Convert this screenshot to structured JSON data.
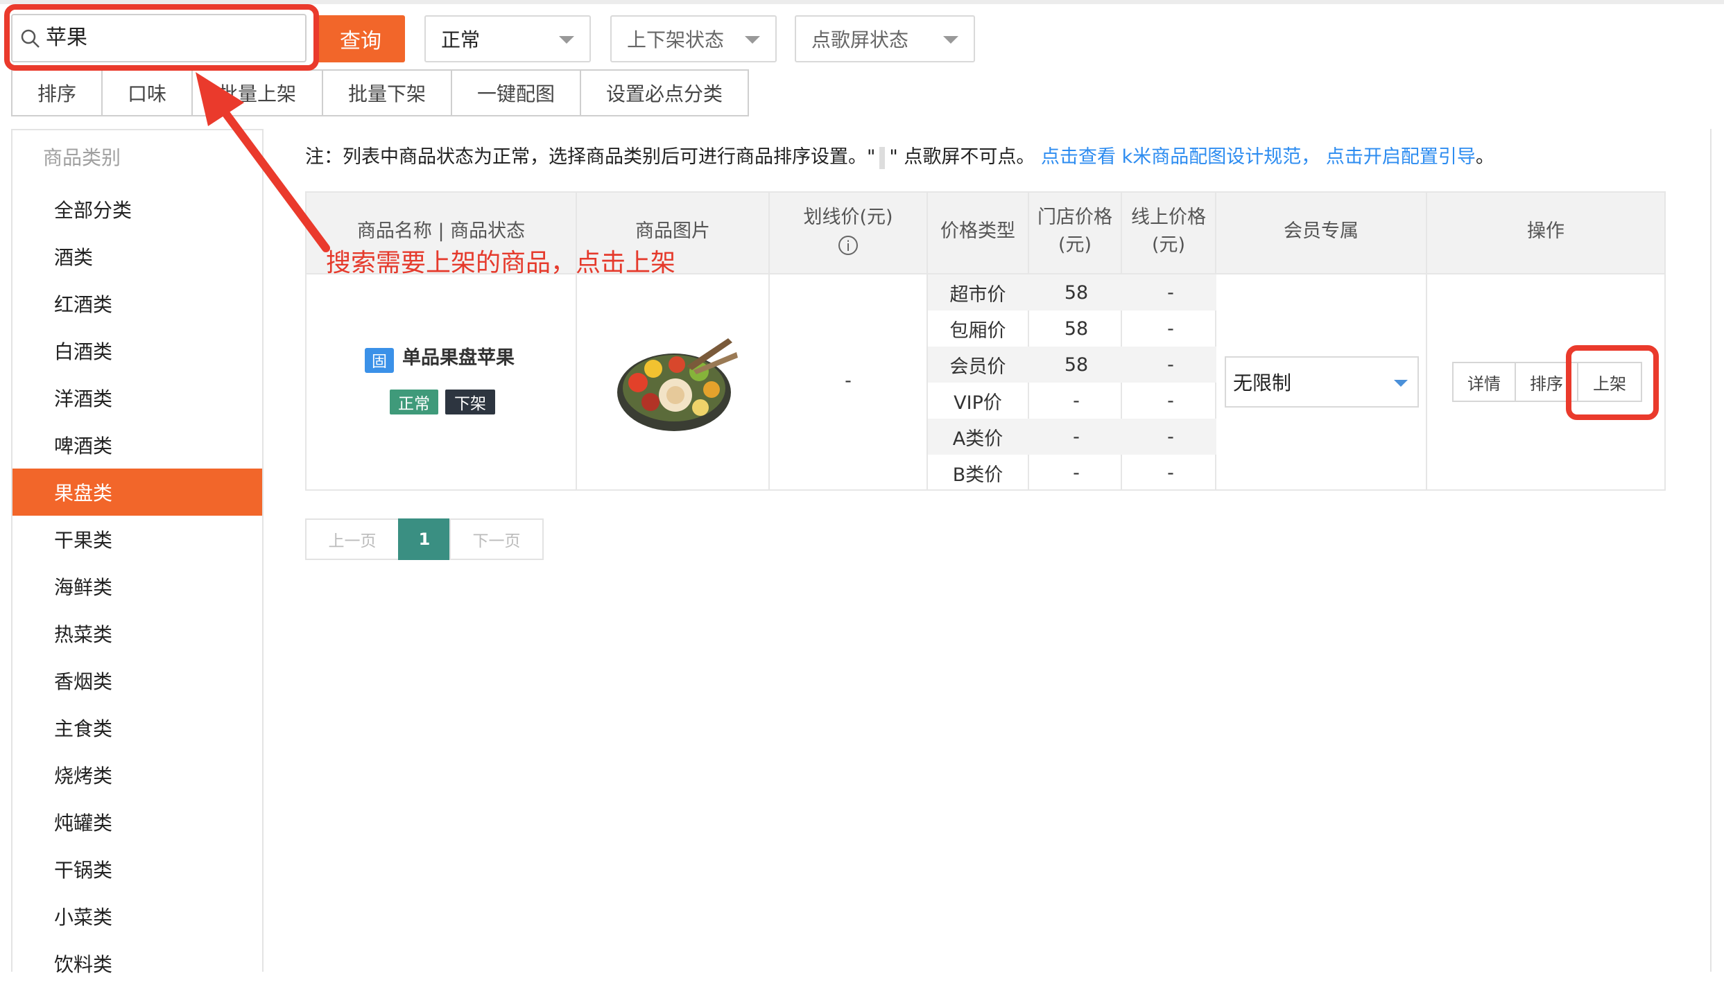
{
  "search": {
    "value": "苹果",
    "button": "查询"
  },
  "filters": {
    "status": "正常",
    "shelf_status": "上下架状态",
    "screen_status": "点歌屏状态"
  },
  "tabs": [
    "排序",
    "口味",
    "批量上架",
    "批量下架",
    "一键配图",
    "设置必点分类"
  ],
  "sidebar": {
    "header": "商品类别",
    "items": [
      "全部分类",
      "酒类",
      "红酒类",
      "白酒类",
      "洋酒类",
      "啤酒类",
      "果盘类",
      "干果类",
      "海鲜类",
      "热菜类",
      "香烟类",
      "主食类",
      "烧烤类",
      "炖罐类",
      "干锅类",
      "小菜类",
      "饮料类"
    ],
    "active_index": 6
  },
  "note": {
    "prefix": "注：列表中商品状态为正常，选择商品类别后可进行商品排序设置。\"",
    "suffix": "\" 点歌屏不可点。",
    "link1": "点击查看 k米商品配图设计规范，",
    "link2": "点击开启配置引导",
    "end": "。"
  },
  "table": {
    "headers": {
      "name": "商品名称 | 商品状态",
      "image": "商品图片",
      "strike_price": "划线价(元)",
      "price_type": "价格类型",
      "store_price": [
        "门店价格",
        "(元)"
      ],
      "online_price": [
        "线上价格",
        "(元)"
      ],
      "member": "会员专属",
      "ops": "操作"
    },
    "row": {
      "badge": "固",
      "name": "单品果盘苹果",
      "tag_status": "正常",
      "tag_shelf": "下架",
      "strike_price": "-",
      "prices": [
        {
          "type": "超市价",
          "store": "58",
          "online": "-"
        },
        {
          "type": "包厢价",
          "store": "58",
          "online": "-"
        },
        {
          "type": "会员价",
          "store": "58",
          "online": "-"
        },
        {
          "type": "VIP价",
          "store": "-",
          "online": "-"
        },
        {
          "type": "A类价",
          "store": "-",
          "online": "-"
        },
        {
          "type": "B类价",
          "store": "-",
          "online": "-"
        }
      ],
      "member_exclusive": "无限制",
      "actions": {
        "detail": "详情",
        "sort": "排序",
        "shelve": "上架"
      }
    }
  },
  "annotation": "搜索需要上架的商品，点击上架",
  "pagination": {
    "prev": "上一页",
    "current": "1",
    "next": "下一页"
  },
  "colors": {
    "accent": "#f2662a",
    "annotation_red": "#ea3a2c",
    "link": "#2d8cf0",
    "pager_active": "#3a8f82"
  }
}
